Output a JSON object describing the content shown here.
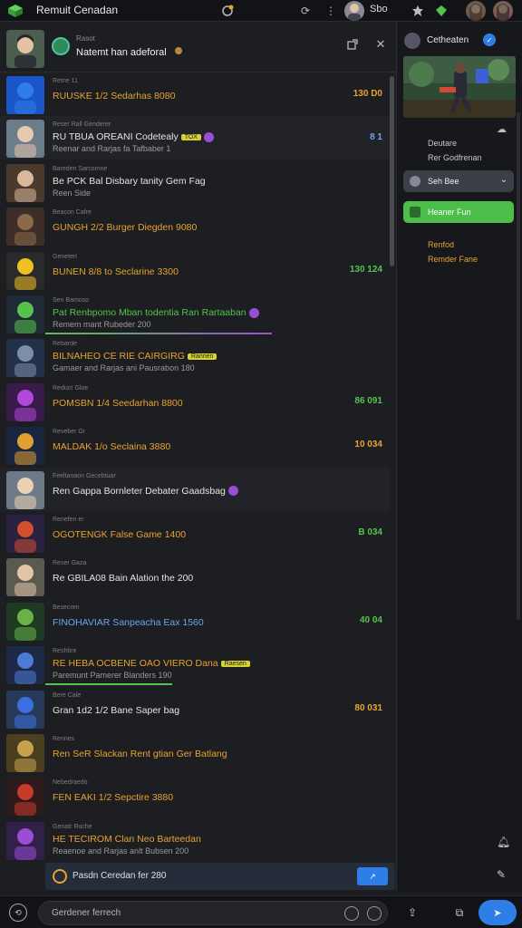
{
  "app": {
    "title": "Remuit Cenadan",
    "user_label": "Sbo"
  },
  "colors": {
    "orange": "#e8a330",
    "green": "#55c24e",
    "blue": "#2f7ee8",
    "purple": "#9b4dd6"
  },
  "feed_header": {
    "sub": "Rasot",
    "title": "Natemt han adeforal"
  },
  "rows": [
    {
      "sub": "Retrie 11",
      "main": "RUUSKE 1/2 Sedarhas 8080",
      "line2": "",
      "score": "130 D0",
      "score_color": "#e8a330",
      "main_color": "#e8a330"
    },
    {
      "sub": "Reser Rall Genderer",
      "main": "RU TBUA OREANI Codetealy",
      "line2": "Reenar and Rarjas fa Tafbaber 1",
      "score": "8 1",
      "score_color": "#6fa3ef",
      "main_color": "#e4e4e4",
      "tag": "TOX"
    },
    {
      "sub": "Bareden Sarcomne",
      "main": "Be PCK Bal Disbary tanity Gem Fag",
      "line2": "Reen Side",
      "score": "",
      "score_color": "#e4e4e4",
      "main_color": "#e4e4e4"
    },
    {
      "sub": "Beacon Cafre",
      "main": "GUNGH 2/2 Burger Diegden 9080",
      "line2": "",
      "score": "",
      "score_color": "#e4e4e4",
      "main_color": "#e8a330"
    },
    {
      "sub": "Geneterl",
      "main": "BUNEN 8/8 to Seclarine 3300",
      "line2": "",
      "score": "130 124",
      "score_color": "#55c24e",
      "main_color": "#e8a330"
    },
    {
      "sub": "Sen Bamoso",
      "main": "Pat Renbpomo Mban todentia Ran Rartaaban",
      "line2": "Remem mant Rubeder 200",
      "score": "",
      "score_color": "#e4e4e4",
      "main_color": "#55c24e"
    },
    {
      "sub": "Rebarde",
      "main": "BILNAHEO CE RIE CAIRGIRG",
      "line2": "Gamaer and Rarjas ani Pausrabon 180",
      "score": "",
      "score_color": "#e4e4e4",
      "main_color": "#e8a330",
      "tag": "Rannen"
    },
    {
      "sub": "Reducr Gloe",
      "main": "POMSBN 1/4 Seedarhan 8800",
      "line2": "",
      "score": "86 091",
      "score_color": "#55c24e",
      "main_color": "#e8a330"
    },
    {
      "sub": "Reveber Gr",
      "main": "MALDAK 1/o Seclaina 3880",
      "line2": "",
      "score": "10 034",
      "score_color": "#e8a330",
      "main_color": "#e8a330"
    },
    {
      "sub": "Feeltanaon Gecebtuar",
      "main": "Ren Gappa Bornleter Debater Gaadsbag",
      "line2": "",
      "score": "",
      "score_color": "#e4e4e4",
      "main_color": "#e4e4e4"
    },
    {
      "sub": "Renefen er",
      "main": "OGOTENGK False Game 1400",
      "line2": "",
      "score": "B 034",
      "score_color": "#55c24e",
      "main_color": "#e8a330"
    },
    {
      "sub": "Reser Gaza",
      "main": "Re GBILA08 Bain Alation the 200",
      "line2": "",
      "score": "",
      "score_color": "#e4e4e4",
      "main_color": "#e4e4e4"
    },
    {
      "sub": "Besecren",
      "main": "FINOHAVIAR Sanpeacha Eax 1560",
      "line2": "",
      "score": "40 04",
      "score_color": "#55c24e",
      "main_color": "#6fa3ef"
    },
    {
      "sub": "Reshbre",
      "main": "RE HEBA OCBENE OAO VIERO Dana",
      "line2": "Paremunt Pamerer Blanders 190",
      "score": "",
      "score_color": "#e4e4e4",
      "main_color": "#e8a330",
      "tag": "Raesen"
    },
    {
      "sub": "Bere Cale",
      "main": "Gran 1d2 1/2 Bane Saper bag",
      "line2": "",
      "score": "80 031",
      "score_color": "#e8a330",
      "main_color": "#e4e4e4"
    },
    {
      "sub": "Rennes",
      "main": "Ren SeR Slackan Rent gtian Ger Batlang",
      "line2": "",
      "score": "",
      "score_color": "#e4e4e4",
      "main_color": "#e8a330"
    },
    {
      "sub": "Nebedraedo",
      "main": "FEN EAKI 1/2 Sepctire 3880",
      "line2": "",
      "score": "",
      "score_color": "#e4e4e4",
      "main_color": "#e8a330"
    },
    {
      "sub": "Genatr Roche",
      "main": "HE TECIROM Clan Neo Barteedan",
      "line2": "Reaenoe and Rarjas anlt Bubsen 200",
      "score": "",
      "score_color": "#e4e4e4",
      "main_color": "#e8a330"
    }
  ],
  "composer": {
    "text": "Pasdn Ceredan fer 280",
    "send": "↗"
  },
  "side": {
    "title": "Cetheaten",
    "line1": "Deutare",
    "line2": "Rer Godfrenan",
    "select": "Seh Bee",
    "button": "Heaner Fun",
    "orange1": "Renfod",
    "orange2": "Remder Fane"
  },
  "bottom": {
    "placeholder": "Gerdener ferrech"
  }
}
